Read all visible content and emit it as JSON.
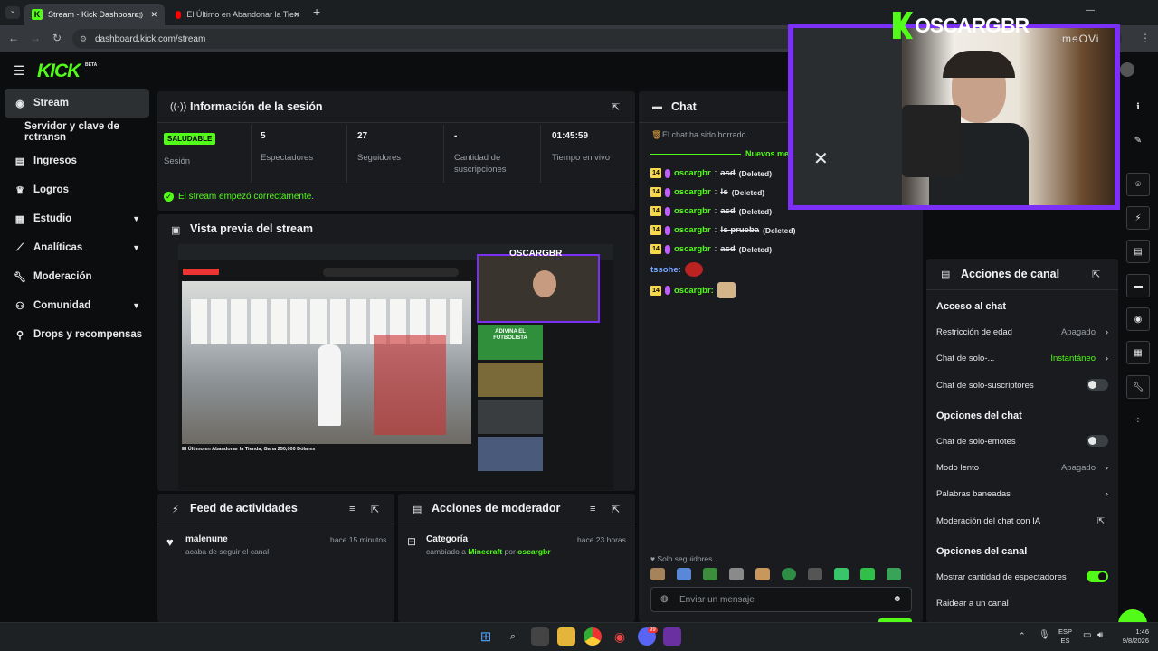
{
  "browser": {
    "tabs": [
      {
        "title": "Stream - Kick Dashboard"
      },
      {
        "title": "El Último en Abandonar la Tien"
      }
    ],
    "new_tab": "+",
    "url": "dashboard.kick.com/stream"
  },
  "kick": {
    "logo": "KICK",
    "beta": "BETA"
  },
  "sidebar": {
    "items": [
      {
        "label": "Stream",
        "icon": "broadcast-icon"
      },
      {
        "label": "Servidor y clave de retransn"
      },
      {
        "label": "Ingresos",
        "icon": "chart-icon"
      },
      {
        "label": "Logros",
        "icon": "trophy-icon"
      },
      {
        "label": "Estudio",
        "icon": "studio-icon"
      },
      {
        "label": "Analíticas",
        "icon": "analytics-icon"
      },
      {
        "label": "Moderación",
        "icon": "wrench-icon"
      },
      {
        "label": "Comunidad",
        "icon": "community-icon"
      },
      {
        "label": "Drops y recompensas",
        "icon": "drops-icon"
      }
    ]
  },
  "session": {
    "title": "Información de la sesión",
    "status_badge": "SALUDABLE",
    "status_label": "Sesión",
    "stats": [
      {
        "value": "5",
        "label": "Espectadores"
      },
      {
        "value": "27",
        "label": "Seguidores"
      },
      {
        "value": "-",
        "label": "Cantidad de suscripciones"
      },
      {
        "value": "01:45:59",
        "label": "Tiempo en vivo"
      }
    ],
    "notice": "El stream empezó correctamente."
  },
  "preview": {
    "title": "Vista previa del stream",
    "overlay_name": "OSCARGBR",
    "video_title": "El Último en Abandonar la Tienda, Gana 250,000 Dólares",
    "side_videos": [
      "ADIVINA EL FUTBOLISTA"
    ]
  },
  "feed": {
    "title": "Feed de actividades",
    "items": [
      {
        "user": "malenune",
        "action": "acaba de seguir el canal",
        "time": "hace 15 minutos"
      }
    ]
  },
  "modactions": {
    "title": "Acciones de moderador",
    "items": [
      {
        "category": "Categoría",
        "prefix": "cambiado a",
        "value": "Minecraft",
        "by": "por",
        "user": "oscargbr",
        "time": "hace 23 horas"
      }
    ]
  },
  "chat": {
    "title": "Chat",
    "cleared": "El chat ha sido borrado.",
    "new_messages": "Nuevos me",
    "badge": "14",
    "messages": [
      {
        "user": "oscargbr",
        "text": "asd",
        "deleted": "(Deleted)"
      },
      {
        "user": "oscargbr",
        "text": "!s",
        "deleted": "(Deleted)"
      },
      {
        "user": "oscargbr",
        "text": "asd",
        "deleted": "(Deleted)"
      },
      {
        "user": "oscargbr",
        "text": "!s prueba",
        "deleted": "(Deleted)"
      },
      {
        "user": "oscargbr",
        "text": "asd",
        "deleted": "(Deleted)"
      }
    ],
    "emote_users": [
      "tssohe:",
      "oscargbr:"
    ],
    "followers_only": "Solo seguidores",
    "input_placeholder": "Enviar un mensaje"
  },
  "webcam": {
    "name": "OSCARGBR",
    "brand": "mɘOVi"
  },
  "channel_actions": {
    "title": "Acciones de canal",
    "sections": [
      {
        "heading": "Acceso al chat"
      },
      {
        "heading": "Opciones del chat"
      },
      {
        "heading": "Opciones del canal"
      }
    ],
    "rows": [
      {
        "label": "Restricción de edad",
        "value": "Apagado"
      },
      {
        "label": "Chat de solo-...",
        "value": "Instantáneo"
      },
      {
        "label": "Chat de solo-suscriptores"
      },
      {
        "label": "Chat de solo-emotes"
      },
      {
        "label": "Modo lento",
        "value": "Apagado"
      },
      {
        "label": "Palabras baneadas"
      },
      {
        "label": "Moderación del chat con IA"
      },
      {
        "label": "Mostrar cantidad de espectadores"
      },
      {
        "label": "Raidear a un canal"
      }
    ],
    "toggles": {
      "solo_suscriptores": false,
      "solo_emotes": false,
      "mostrar_espectadores": true
    }
  },
  "taskbar": {
    "lang1": "ESP",
    "lang2": "ES",
    "time": "1:46",
    "date": "9/8/2026",
    "discord_badge": "99"
  },
  "colors": {
    "kick_green": "#53fc18",
    "panel": "#191b1f",
    "purple": "#7b2ff7"
  }
}
